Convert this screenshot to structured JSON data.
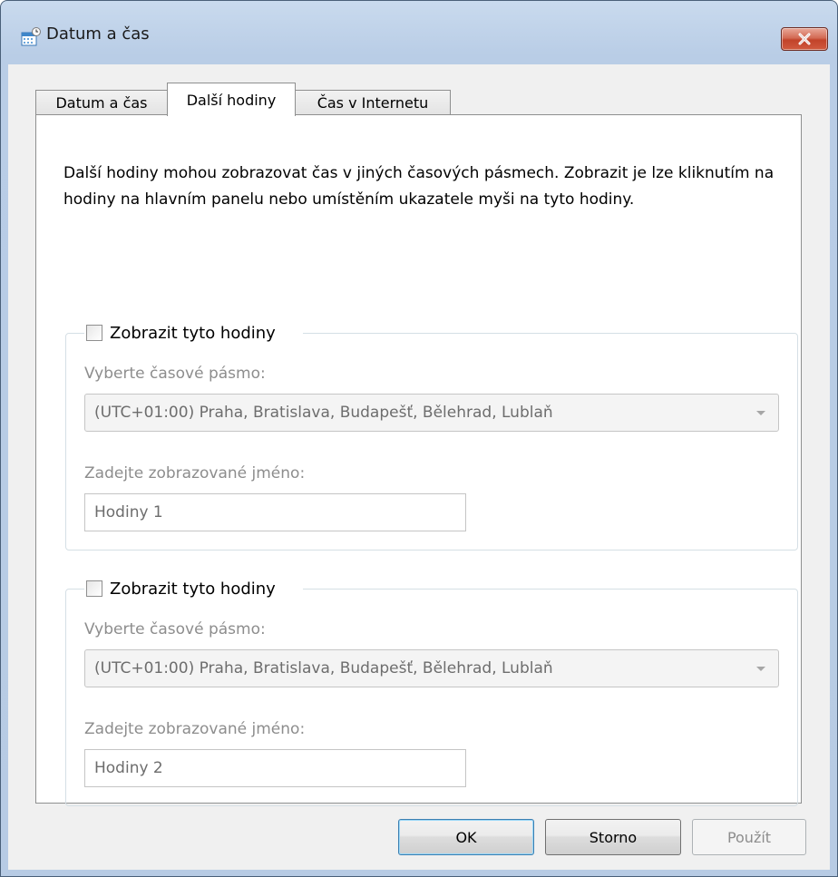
{
  "window": {
    "title": "Datum a čas"
  },
  "tabs": [
    {
      "label": "Datum a čas"
    },
    {
      "label": "Další hodiny"
    },
    {
      "label": "Čas v Internetu"
    }
  ],
  "description": "Další hodiny mohou zobrazovat čas v jiných časových pásmech. Zobrazit je lze kliknutím na hodiny na hlavním panelu nebo umístěním ukazatele myši na tyto hodiny.",
  "clocks": [
    {
      "show_label": "Zobrazit tyto hodiny",
      "checked": false,
      "timezone_label": "Vyberte časové pásmo:",
      "timezone_value": "(UTC+01:00) Praha, Bratislava, Budapešť, Bělehrad, Lublaň",
      "name_label": "Zadejte zobrazované jméno:",
      "name_value": "Hodiny 1"
    },
    {
      "show_label": "Zobrazit tyto hodiny",
      "checked": false,
      "timezone_label": "Vyberte časové pásmo:",
      "timezone_value": "(UTC+01:00) Praha, Bratislava, Budapešť, Bělehrad, Lublaň",
      "name_label": "Zadejte zobrazované jméno:",
      "name_value": "Hodiny 2"
    }
  ],
  "buttons": {
    "ok": "OK",
    "cancel": "Storno",
    "apply": "Použít"
  },
  "icons": {
    "title": "calendar-clock-icon",
    "close": "close-icon",
    "dropdown": "chevron-down-icon"
  },
  "colors": {
    "close_button": "#c2432a",
    "default_button_border": "#3c7fb1",
    "disabled_text": "#8d8d8d"
  }
}
